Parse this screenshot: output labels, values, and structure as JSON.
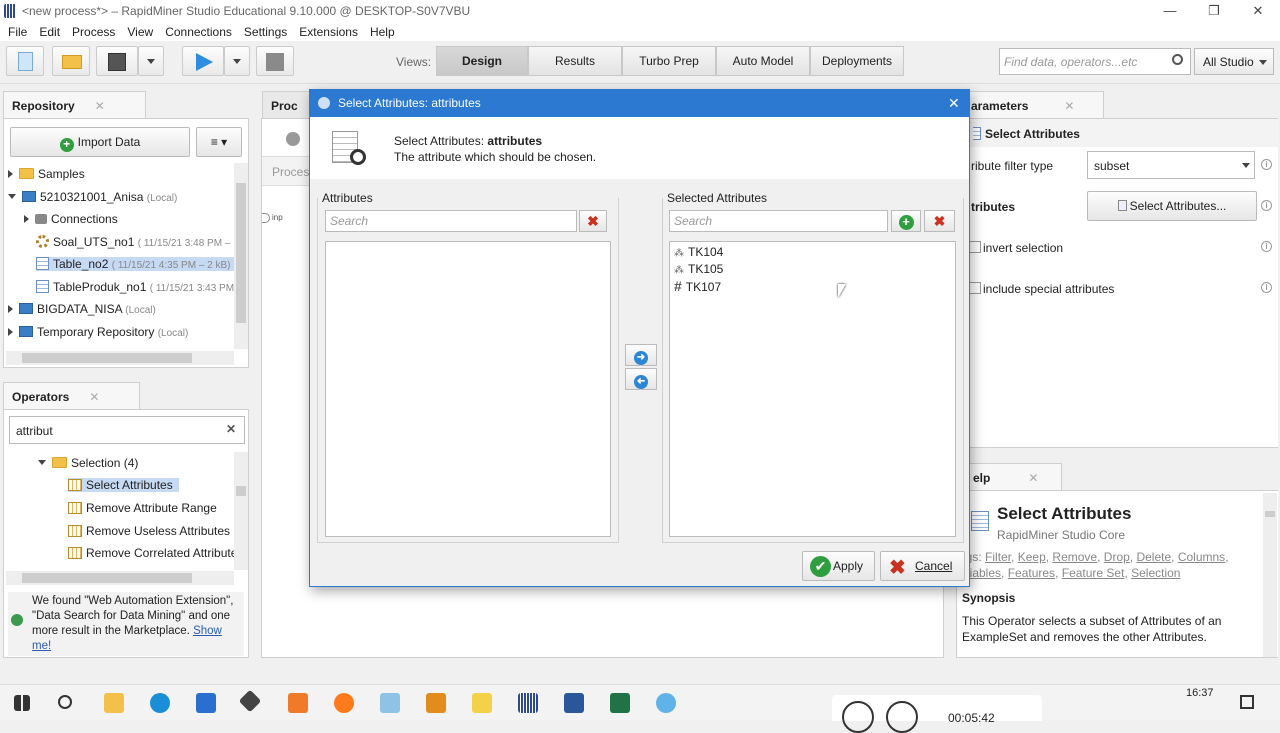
{
  "window": {
    "title": "<new process*> – RapidMiner Studio Educational 9.10.000 @ DESKTOP-S0V7VBU",
    "minimize": "—",
    "restore": "❐",
    "close": "✕"
  },
  "menu": [
    "File",
    "Edit",
    "Process",
    "View",
    "Connections",
    "Settings",
    "Extensions",
    "Help"
  ],
  "views": {
    "label": "Views:",
    "items": [
      "Design",
      "Results",
      "Turbo Prep",
      "Auto Model",
      "Deployments"
    ],
    "active": "Design"
  },
  "search": {
    "placeholder": "Find data, operators...etc",
    "scope": "All Studio"
  },
  "repository": {
    "title": "Repository",
    "import_label": "Import Data",
    "items": [
      {
        "label": "Samples",
        "meta": ""
      },
      {
        "label": "5210321001_Anisa",
        "meta": "(Local)"
      },
      {
        "label": "Connections",
        "meta": ""
      },
      {
        "label": "Soal_UTS_no1",
        "meta": "( 11/15/21 3:48 PM –"
      },
      {
        "label": "Table_no2",
        "meta": "( 11/15/21 4:35 PM – 2 kB)"
      },
      {
        "label": "TableProduk_no1",
        "meta": "( 11/15/21 3:43 PM"
      },
      {
        "label": "BIGDATA_NISA",
        "meta": "(Local)"
      },
      {
        "label": "Temporary Repository",
        "meta": "(Local)"
      }
    ]
  },
  "operators": {
    "title": "Operators",
    "search_value": "attribut",
    "group": "Selection (4)",
    "items": [
      "Select Attributes",
      "Remove Attribute Range",
      "Remove Useless Attributes",
      "Remove Correlated Attributes"
    ],
    "notice_text": "We found \"Web Automation Extension\", \"Data Search for Data Mining\" and one more result in the Marketplace.",
    "notice_link": "Show me!"
  },
  "process": {
    "tab_label": "Proc",
    "sub_label": "Proces",
    "port_label": "inp"
  },
  "parameters": {
    "title": "arameters",
    "operator": "Select Attributes",
    "rows": [
      {
        "label": "ribute filter type",
        "value": "subset"
      },
      {
        "label": "tributes",
        "value": "Select Attributes..."
      },
      {
        "label": "invert selection",
        "value": ""
      },
      {
        "label": "include special attributes",
        "value": ""
      }
    ]
  },
  "help": {
    "title": "elp",
    "op_title": "Select Attributes",
    "op_sub": "RapidMiner Studio Core",
    "tags_prefix": "ags:",
    "tags": [
      "Filter",
      "Keep",
      "Remove",
      "Drop",
      "Delete",
      "Columns",
      "ariables",
      "Features",
      "Feature Set",
      "Selection"
    ],
    "synopsis_title": "Synopsis",
    "synopsis": "This Operator selects a subset of Attributes of an ExampleSet and removes the other Attributes."
  },
  "dialog": {
    "title": "Select Attributes: attributes",
    "header_prefix": "Select Attributes: ",
    "header_bold": "attributes",
    "description": "The attribute which should be chosen.",
    "left_label": "Attributes",
    "right_label": "Selected Attributes",
    "search_placeholder": "Search",
    "selected": [
      {
        "name": "TK104",
        "type": "nominal"
      },
      {
        "name": "TK105",
        "type": "nominal"
      },
      {
        "name": "TK107",
        "type": "numeric"
      }
    ],
    "apply_label": "Apply",
    "cancel_label": "Cancel"
  },
  "taskbar": {
    "time": "16:37",
    "timer": "00:05:42"
  }
}
